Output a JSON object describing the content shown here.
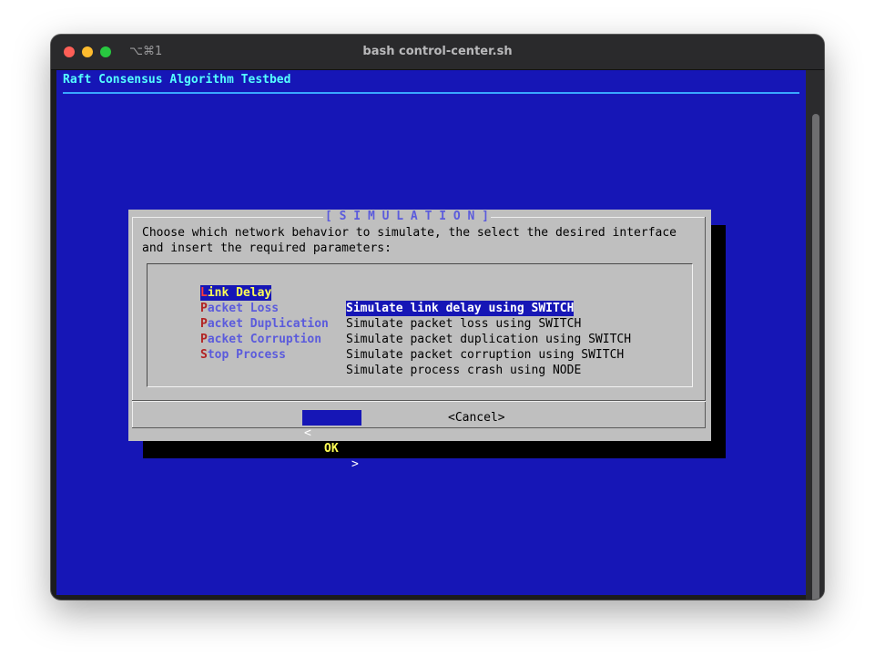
{
  "window": {
    "title": "bash control-center.sh",
    "shortcut": "⌥⌘1"
  },
  "app": {
    "title": "Raft Consensus Algorithm Testbed"
  },
  "dialog": {
    "title": "[ S I M U L A T I O N ]",
    "prompt": "Choose which network behavior to simulate, the select the desired interface\nand insert the required parameters:",
    "items": [
      {
        "hotkey": "L",
        "rest": "ink Delay",
        "desc": "Simulate link delay using SWITCH",
        "selected": true
      },
      {
        "hotkey": "P",
        "rest": "acket Loss",
        "desc": "Simulate packet loss using SWITCH",
        "selected": false
      },
      {
        "hotkey": "P",
        "rest": "acket Duplication",
        "desc": "Simulate packet duplication using SWITCH",
        "selected": false
      },
      {
        "hotkey": "P",
        "rest": "acket Corruption",
        "desc": "Simulate packet corruption using SWITCH",
        "selected": false
      },
      {
        "hotkey": "S",
        "rest": "top Process",
        "desc": "Simulate process crash using NODE",
        "selected": false
      }
    ],
    "ok": {
      "left": "<",
      "label": "OK",
      "right": ">"
    },
    "cancel_label": "<Cancel>"
  },
  "colors": {
    "terminal_bg": "#1616b6",
    "dialog_bg": "#bfbfbf",
    "title_cyan": "#55ffff",
    "highlight_yellow": "#ffff55",
    "hotkey_red": "#b22222"
  }
}
